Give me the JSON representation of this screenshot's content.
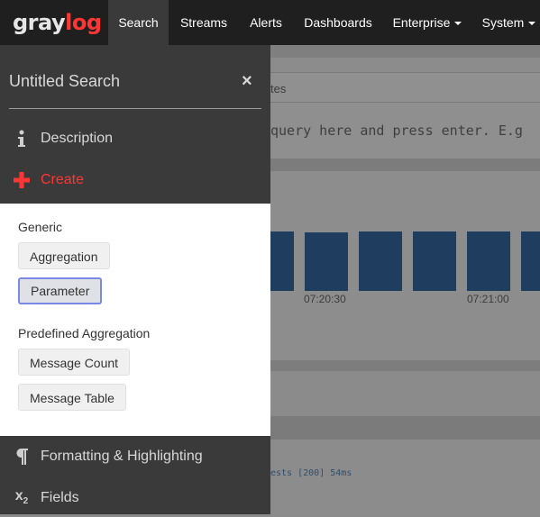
{
  "navbar": {
    "logo_gray": "gray",
    "logo_log": "log",
    "items": [
      {
        "label": "Search",
        "active": true
      },
      {
        "label": "Streams"
      },
      {
        "label": "Alerts"
      },
      {
        "label": "Dashboards"
      },
      {
        "label": "Enterprise",
        "dropdown": true
      },
      {
        "label": "System",
        "dropdown": true
      }
    ]
  },
  "background": {
    "tab_fragment": "tes",
    "query_placeholder_fragment": "query here and press enter. E.g",
    "ticks": [
      "07:20:30",
      "07:21:00"
    ],
    "log_fragment": "ests [200] 54ms"
  },
  "sidebar": {
    "title": "Untitled Search",
    "close_icon": "×",
    "items": [
      {
        "label": "Description",
        "icon": "info-icon"
      },
      {
        "label": "Create",
        "icon": "plus-icon"
      },
      {
        "label": "Formatting & Highlighting",
        "icon": "paragraph-icon"
      },
      {
        "label": "Fields",
        "icon": "subscript-icon"
      }
    ]
  },
  "create_panel": {
    "generic_label": "Generic",
    "generic_buttons": [
      "Aggregation",
      "Parameter"
    ],
    "predefined_label": "Predefined Aggregation",
    "predefined_buttons": [
      "Message Count",
      "Message Table"
    ]
  },
  "colors": {
    "brand_red": "#ff3633",
    "navbar": "#1f1f1f",
    "sidebar": "#3a3a3a",
    "bar": "#1f3d5e",
    "focus": "#7a88e6"
  }
}
